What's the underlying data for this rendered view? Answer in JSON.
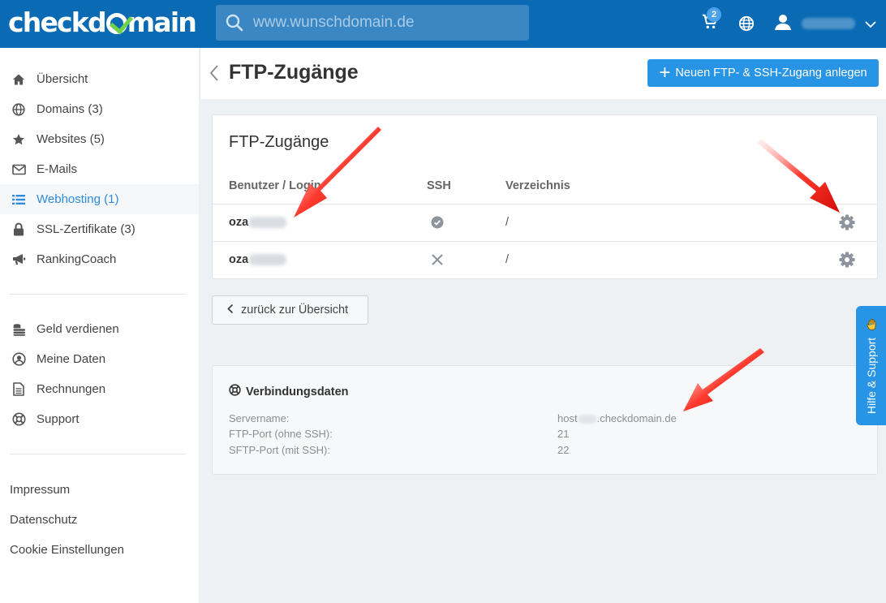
{
  "brand": {
    "logo_text_before": "checkd",
    "logo_text_after": "main",
    "accent": "#0a6ab4",
    "check_color": "#6fd14c"
  },
  "search": {
    "placeholder": "www.wunschdomain.de"
  },
  "topbar": {
    "cart_count": "2",
    "cart_icon": "cart-icon",
    "globe_icon": "globe-icon",
    "user_icon": "user-icon"
  },
  "sidebar": {
    "items": [
      {
        "label": "Übersicht",
        "icon": "home-icon"
      },
      {
        "label": "Domains (3)",
        "icon": "globe-icon"
      },
      {
        "label": "Websites (5)",
        "icon": "star-icon"
      },
      {
        "label": "E-Mails",
        "icon": "mail-icon"
      },
      {
        "label": "Webhosting (1)",
        "icon": "list-icon",
        "active": true
      },
      {
        "label": "SSL-Zertifikate (3)",
        "icon": "lock-icon"
      },
      {
        "label": "RankingCoach",
        "icon": "megaphone-icon"
      }
    ],
    "items2": [
      {
        "label": "Geld verdienen",
        "icon": "coins-icon"
      },
      {
        "label": "Meine Daten",
        "icon": "user-circle-icon"
      },
      {
        "label": "Rechnungen",
        "icon": "document-icon"
      },
      {
        "label": "Support",
        "icon": "lifebuoy-icon"
      }
    ],
    "footer": [
      "Impressum",
      "Datenschutz",
      "Cookie Einstellungen"
    ]
  },
  "header": {
    "title": "FTP-Zugänge",
    "primary_button": "Neuen FTP- & SSH-Zugang anlegen"
  },
  "card": {
    "title": "FTP-Zugänge",
    "columns": [
      "Benutzer / Login",
      "SSH",
      "Verzeichnis"
    ],
    "rows": [
      {
        "login": "oza",
        "ssh": "check",
        "directory": "/"
      },
      {
        "login": "oza",
        "ssh": "cross",
        "directory": "/"
      }
    ]
  },
  "back_button": "zurück zur Übersicht",
  "connection": {
    "title": "Verbindungsdaten",
    "fields": [
      {
        "label": "Servername:",
        "value_prefix": "host",
        "value_suffix": ".checkdomain.de"
      },
      {
        "label": "FTP-Port (ohne SSH):",
        "value": "21"
      },
      {
        "label": "SFTP-Port (mit SSH):",
        "value": "22"
      }
    ]
  },
  "help_tab": {
    "label": "Hilfe & Support",
    "color": "#2794e6"
  },
  "colors": {
    "primary_button": "#2794e6",
    "active_nav": "#2e8ce0",
    "arrow": "#e8201c"
  }
}
